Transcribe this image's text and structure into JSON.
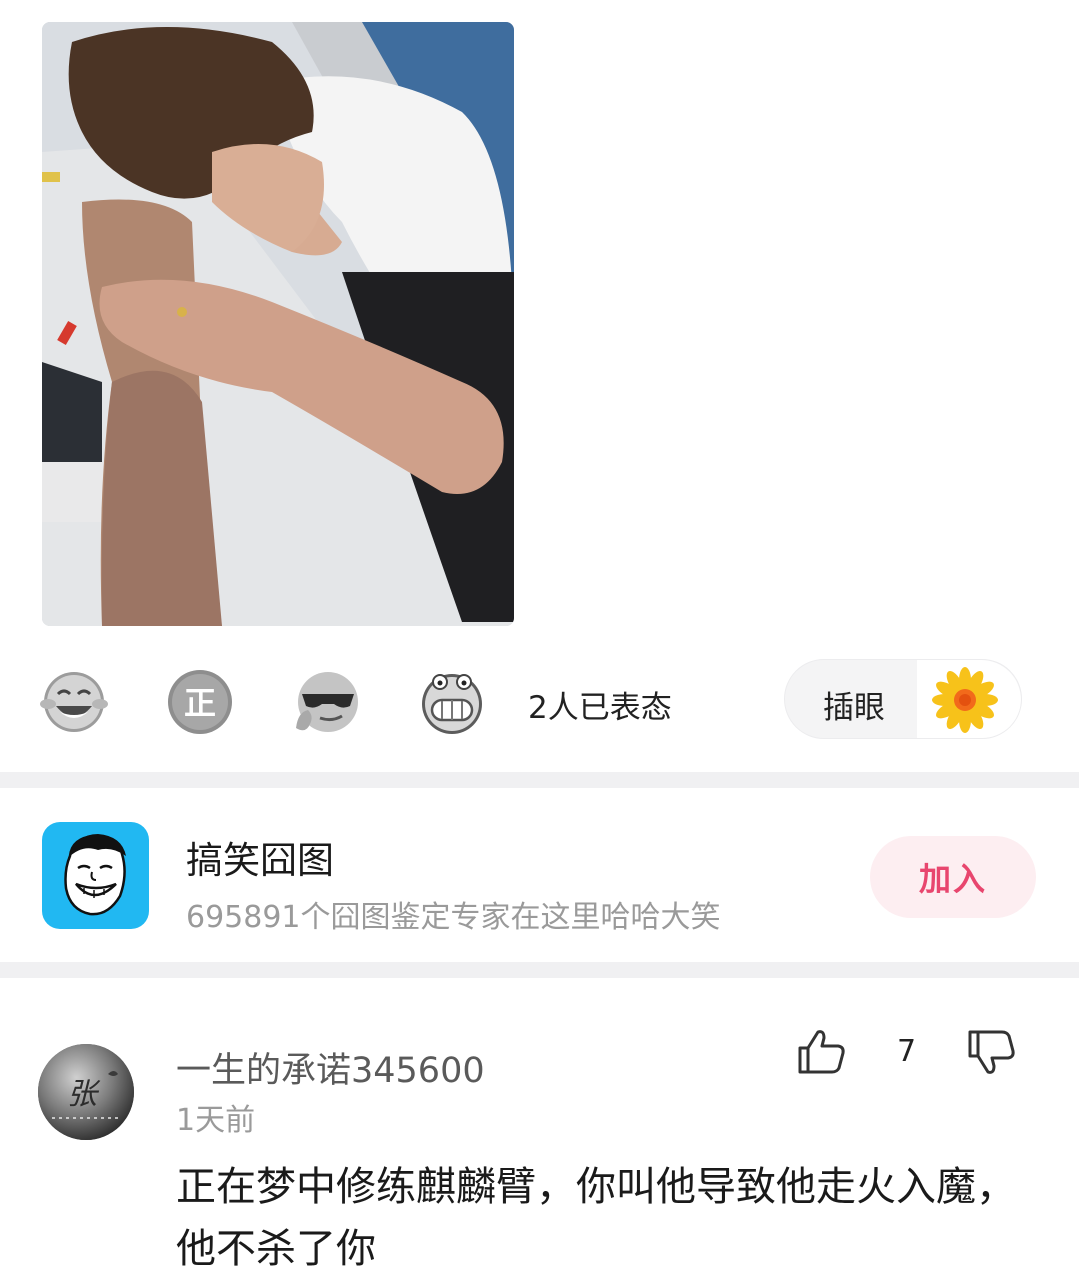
{
  "post": {
    "photo_alt": "",
    "reactions": [
      {
        "icon": "laughing-tears-emoji-icon"
      },
      {
        "icon": "zheng-badge-emoji-icon"
      },
      {
        "icon": "sunglasses-emoji-icon"
      },
      {
        "icon": "grinning-teeth-emoji-icon"
      }
    ],
    "reaction_count": "2人已表态",
    "vote_label": "插眼",
    "vote_icon": "sunflower-icon",
    "zheng_glyph": "正"
  },
  "group": {
    "name": "搞笑囧图",
    "description": "695891个囧图鉴定专家在这里哈哈大笑",
    "join_label": "加入",
    "avatar_icon": "meme-face-icon"
  },
  "comment": {
    "username": "一生的承诺345600",
    "time": "1天前",
    "likes": "7",
    "text": "正在梦中修练麒麟臂，你叫他导致他走火入魔，他不杀了你",
    "avatar_glyph": "张"
  },
  "colors": {
    "accent_pink": "#e8466e",
    "join_bg": "#fdeef1",
    "group_avatar_bg": "#21b8f2",
    "divider": "#f0f0f2"
  }
}
